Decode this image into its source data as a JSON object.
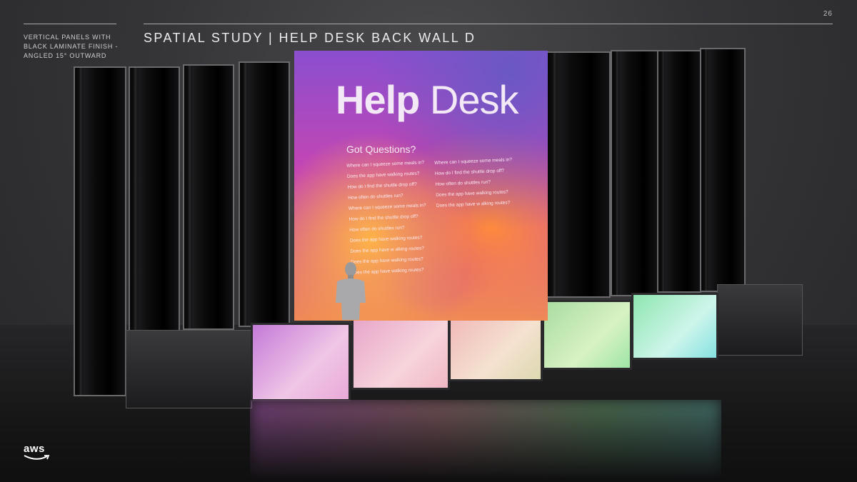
{
  "page": {
    "number": "26",
    "title": "SPATIAL STUDY | HELP DESK BACK WALL D",
    "side_note": "VERTICAL PANELS WITH BLACK LAMINATE FINISH - ANGLED 15° OUTWARD"
  },
  "screen": {
    "title_bold": "Help",
    "title_regular": "Desk",
    "subtitle": "Got Questions?",
    "questions_left": [
      "Where can I squeeze some meals in?",
      "Does the app have walking routes?",
      "How do I find the shuttle drop off?",
      "How often do shuttles run?",
      "Where can I squeeze some meals in?",
      "How do I find the shuttle drop off?",
      "How often do shuttles run?",
      "Does the app have walking routes?",
      "Does the app have w alking routes?",
      "Does the app have walking routes?",
      "Does the app have walking routes?"
    ],
    "questions_right": [
      "Where can I squeeze some meals in?",
      "How do I find the shuttle drop off?",
      "How often do shuttles run?",
      "Does the app have walking routes?",
      "Does the app have w alking routes?"
    ]
  },
  "brand": {
    "logo_text": "aws",
    "accent_colors": [
      "#8a4fcf",
      "#c545b3",
      "#f08a55",
      "#7fe0a0",
      "#7ee0e0"
    ]
  }
}
